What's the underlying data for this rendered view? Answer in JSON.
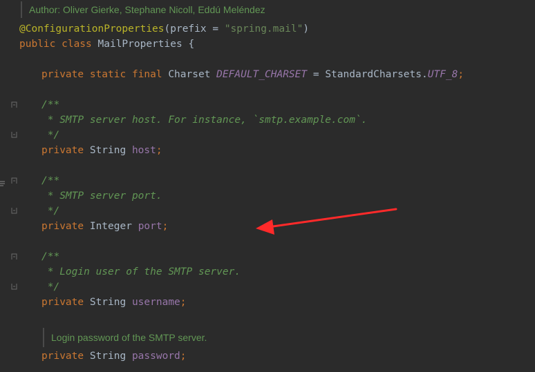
{
  "doc_comments": {
    "author": "Author: Oliver Gierke, Stephane Nicoll, Eddú Meléndez",
    "password": "Login password of the SMTP server."
  },
  "code": {
    "annotation": "@ConfigurationProperties",
    "annotation_open": "(prefix = ",
    "annotation_value": "\"spring.mail\"",
    "annotation_close": ")",
    "class_kw": "public class ",
    "class_name": "MailProperties {",
    "charset_modifiers": "private static final ",
    "charset_type": "Charset ",
    "charset_const": "DEFAULT_CHARSET",
    "charset_assign": " = StandardCharsets.",
    "charset_value": "UTF_8",
    "charset_end": ";",
    "comment_open": "/**",
    "comment_close": " */",
    "host_comment": " * SMTP server host. For instance, `smtp.example.com`.",
    "host_private": "private ",
    "host_type": "String ",
    "host_name": "host",
    "host_end": ";",
    "port_comment": " * SMTP server port.",
    "port_private": "private ",
    "port_type": "Integer ",
    "port_name": "port",
    "port_end": ";",
    "username_comment": " * Login user of the SMTP server.",
    "username_private": "private ",
    "username_type": "String ",
    "username_name": "username",
    "username_end": ";",
    "password_private": "private ",
    "password_type": "String ",
    "password_name": "password",
    "password_end": ";"
  },
  "colors": {
    "background": "#2b2b2b",
    "keyword": "#cc7832",
    "annotation": "#bbb529",
    "string": "#6a8759",
    "field": "#9876aa",
    "comment": "#629755",
    "default_text": "#a9b7c6",
    "arrow": "#ff2a2a"
  },
  "icons": [
    "fold-marker-icon",
    "structure-icon",
    "annotation-arrow-icon"
  ]
}
